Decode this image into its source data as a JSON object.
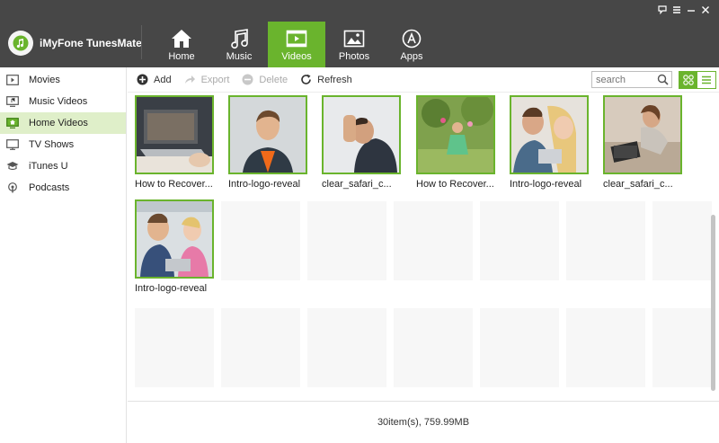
{
  "app": {
    "title": "iMyFone TunesMate",
    "accent": "#6ab42d"
  },
  "nav": [
    {
      "label": "Home",
      "icon": "home-icon"
    },
    {
      "label": "Music",
      "icon": "music-icon"
    },
    {
      "label": "Videos",
      "icon": "videos-icon",
      "active": true
    },
    {
      "label": "Photos",
      "icon": "photos-icon"
    },
    {
      "label": "Apps",
      "icon": "apps-icon"
    }
  ],
  "sidebar": {
    "items": [
      {
        "label": "Movies",
        "icon": "movies-icon"
      },
      {
        "label": "Music Videos",
        "icon": "music-videos-icon"
      },
      {
        "label": "Home Videos",
        "icon": "home-videos-icon",
        "active": true
      },
      {
        "label": "TV Shows",
        "icon": "tv-shows-icon"
      },
      {
        "label": "iTunes U",
        "icon": "itunes-u-icon"
      },
      {
        "label": "Podcasts",
        "icon": "podcasts-icon"
      }
    ]
  },
  "toolbar": {
    "add_label": "Add",
    "export_label": "Export",
    "delete_label": "Delete",
    "refresh_label": "Refresh",
    "search_placeholder": "search"
  },
  "videos": [
    {
      "caption": "How to Recover..."
    },
    {
      "caption": "Intro-logo-reveal"
    },
    {
      "caption": "clear_safari_c..."
    },
    {
      "caption": "How to Recover..."
    },
    {
      "caption": "Intro-logo-reveal"
    },
    {
      "caption": "clear_safari_c..."
    },
    {
      "caption": "Intro-logo-reveal"
    }
  ],
  "status": {
    "text": "30item(s), 759.99MB"
  }
}
